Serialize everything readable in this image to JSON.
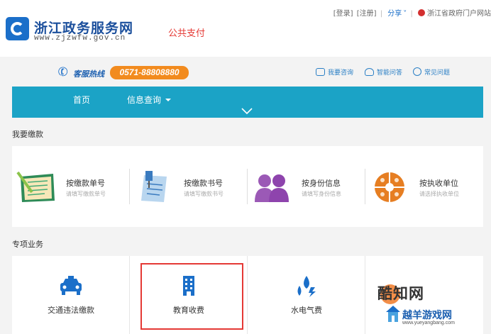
{
  "header": {
    "site_title": "浙江政务服务网",
    "site_url": "www.zjzwfw.gov.cn",
    "page_title": "公共支付",
    "links": {
      "login": "[登录]",
      "register": "[注册]",
      "separator": "|",
      "share": "分享",
      "portal": "浙江省政府门户网站"
    }
  },
  "hotline": {
    "label": "客服热线",
    "number": "0571-88808880"
  },
  "help_links": [
    {
      "label": "我要咨询",
      "icon": "chat-icon"
    },
    {
      "label": "智能问答",
      "icon": "robot-icon"
    },
    {
      "label": "常见问题",
      "icon": "question-icon"
    }
  ],
  "nav": {
    "home": "首页",
    "query": "信息查询"
  },
  "sections": {
    "pay": "我要缴款",
    "services": "专项业务"
  },
  "pay_methods": [
    {
      "title": "按缴款单号",
      "subtitle": "请填写缴款单号",
      "icon": "form-sheet-icon"
    },
    {
      "title": "按缴款书号",
      "subtitle": "请填写缴款书号",
      "icon": "document-pin-icon"
    },
    {
      "title": "按身份信息",
      "subtitle": "请填写身份信息",
      "icon": "people-icon"
    },
    {
      "title": "按执收单位",
      "subtitle": "请选择执收单位",
      "icon": "unit-pie-icon"
    }
  ],
  "services": [
    {
      "label": "交通违法缴款",
      "icon": "car-icon"
    },
    {
      "label": "教育收费",
      "icon": "building-icon"
    },
    {
      "label": "水电气费",
      "icon": "utilities-icon"
    },
    {
      "label": "",
      "icon": "more-icon"
    }
  ],
  "watermark": {
    "cool": "酷知网",
    "site": "越羊游戏网",
    "url": "www.yueyangbang.com"
  },
  "colors": {
    "nav_bg": "#1ba3c6",
    "hotline_bg": "#f28b1e",
    "brand_blue": "#1b6fc9",
    "highlight": "#e53935"
  }
}
